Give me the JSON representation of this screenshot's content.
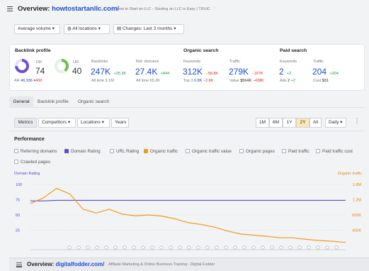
{
  "header": {
    "menu_icon": "hamburger-icon",
    "overview_prefix": "Overview:",
    "domain": "howtostartanllc.com/",
    "site_title": "How to Start an LLC - Starting an LLC is Easy | TRUiC"
  },
  "filters": {
    "volume": "Average volume",
    "locations": "All locations",
    "changes": "Changes: Last 3 months"
  },
  "backlink_profile": {
    "title": "Backlink profile",
    "dr_label": "DR",
    "dr_value": "74",
    "ar_label": "AR",
    "ar_value": "46,936",
    "ar_change": "▾400",
    "ur_label": "UR",
    "ur_value": "40",
    "backlinks_label": "Backlinks",
    "backlinks_value": "247K",
    "backlinks_change": "+25.3K",
    "backlinks_sub": "All time  3.1M",
    "refdomains_label": "Ref. domains",
    "refdomains_value": "27.4K",
    "refdomains_change": "+844",
    "refdomains_sub": "All time  65.2K"
  },
  "organic_search": {
    "title": "Organic search",
    "keywords_label": "Keywords",
    "keywords_value": "312K",
    "keywords_change": "−58.8K",
    "keywords_sub_prefix": "Top 3",
    "keywords_sub_value": "6.8K",
    "keywords_sub_change": "−2.8K",
    "traffic_label": "Traffic",
    "traffic_value": "279K",
    "traffic_change": "−167K",
    "traffic_sub_prefix": "Value",
    "traffic_sub_value": "$564K",
    "traffic_sub_change": "−438K"
  },
  "paid_search": {
    "title": "Paid search",
    "keywords_label": "Keywords",
    "keywords_value": "2",
    "keywords_change": "+2",
    "keywords_sub_prefix": "Ads",
    "keywords_sub_value": "2",
    "keywords_sub_change": "+2",
    "traffic_label": "Traffic",
    "traffic_value": "204",
    "traffic_change": "+204",
    "traffic_sub_prefix": "Cost",
    "traffic_sub_value": "$31"
  },
  "tabs": [
    "General",
    "Backlink profile",
    "Organic search"
  ],
  "toolbar": {
    "metrics": "Metrics",
    "competitors": "Competitors",
    "locations": "Locations",
    "years": "Years",
    "ranges": [
      "1M",
      "6M",
      "1Y",
      "2Y",
      "All"
    ],
    "active_range": "2Y",
    "interval": "Daily"
  },
  "performance": {
    "title": "Performance",
    "checkboxes": [
      {
        "label": "Referring domains",
        "checked": false
      },
      {
        "label": "Domain Rating",
        "checked": true,
        "color": "#5b4bd8"
      },
      {
        "label": "URL Rating",
        "checked": false
      },
      {
        "label": "Organic traffic",
        "checked": true,
        "color": "#f09a1a"
      },
      {
        "label": "Organic traffic value",
        "checked": false
      },
      {
        "label": "Organic pages",
        "checked": false
      },
      {
        "label": "Paid traffic",
        "checked": false
      },
      {
        "label": "Paid traffic cost",
        "checked": false
      },
      {
        "label": "Crawled pages",
        "checked": false
      }
    ]
  },
  "chart_data": {
    "type": "line",
    "left_axis_label": "Domain Rating",
    "right_axis_label": "Organic traffic",
    "left_ticks": [
      "100",
      "75",
      "50",
      "25"
    ],
    "right_ticks": [
      "1.8M",
      "1.2M",
      "600K",
      "400K"
    ],
    "series": [
      {
        "name": "Domain Rating",
        "color": "#5b4bd8",
        "values": [
          73,
          73,
          74,
          74,
          74,
          74,
          74,
          74,
          74,
          74,
          74,
          74,
          74,
          74,
          74,
          74,
          74,
          74,
          74,
          74,
          74,
          74,
          74,
          74,
          74
        ]
      },
      {
        "name": "Organic traffic",
        "color": "#f39a1a",
        "values": [
          1.3,
          1.45,
          1.7,
          1.55,
          1.15,
          1.05,
          1.15,
          1.02,
          0.98,
          1.0,
          0.97,
          0.9,
          0.8,
          0.75,
          0.68,
          0.58,
          0.5,
          0.47,
          0.44,
          0.4,
          0.4,
          0.36,
          0.33,
          0.31,
          0.28
        ]
      }
    ]
  },
  "bottom_bar": {
    "overview_prefix": "Overview:",
    "domain": "digitalfodder.com/",
    "site_title": "Affiliate Marketing & Online Business Training - Digital Fodder"
  }
}
